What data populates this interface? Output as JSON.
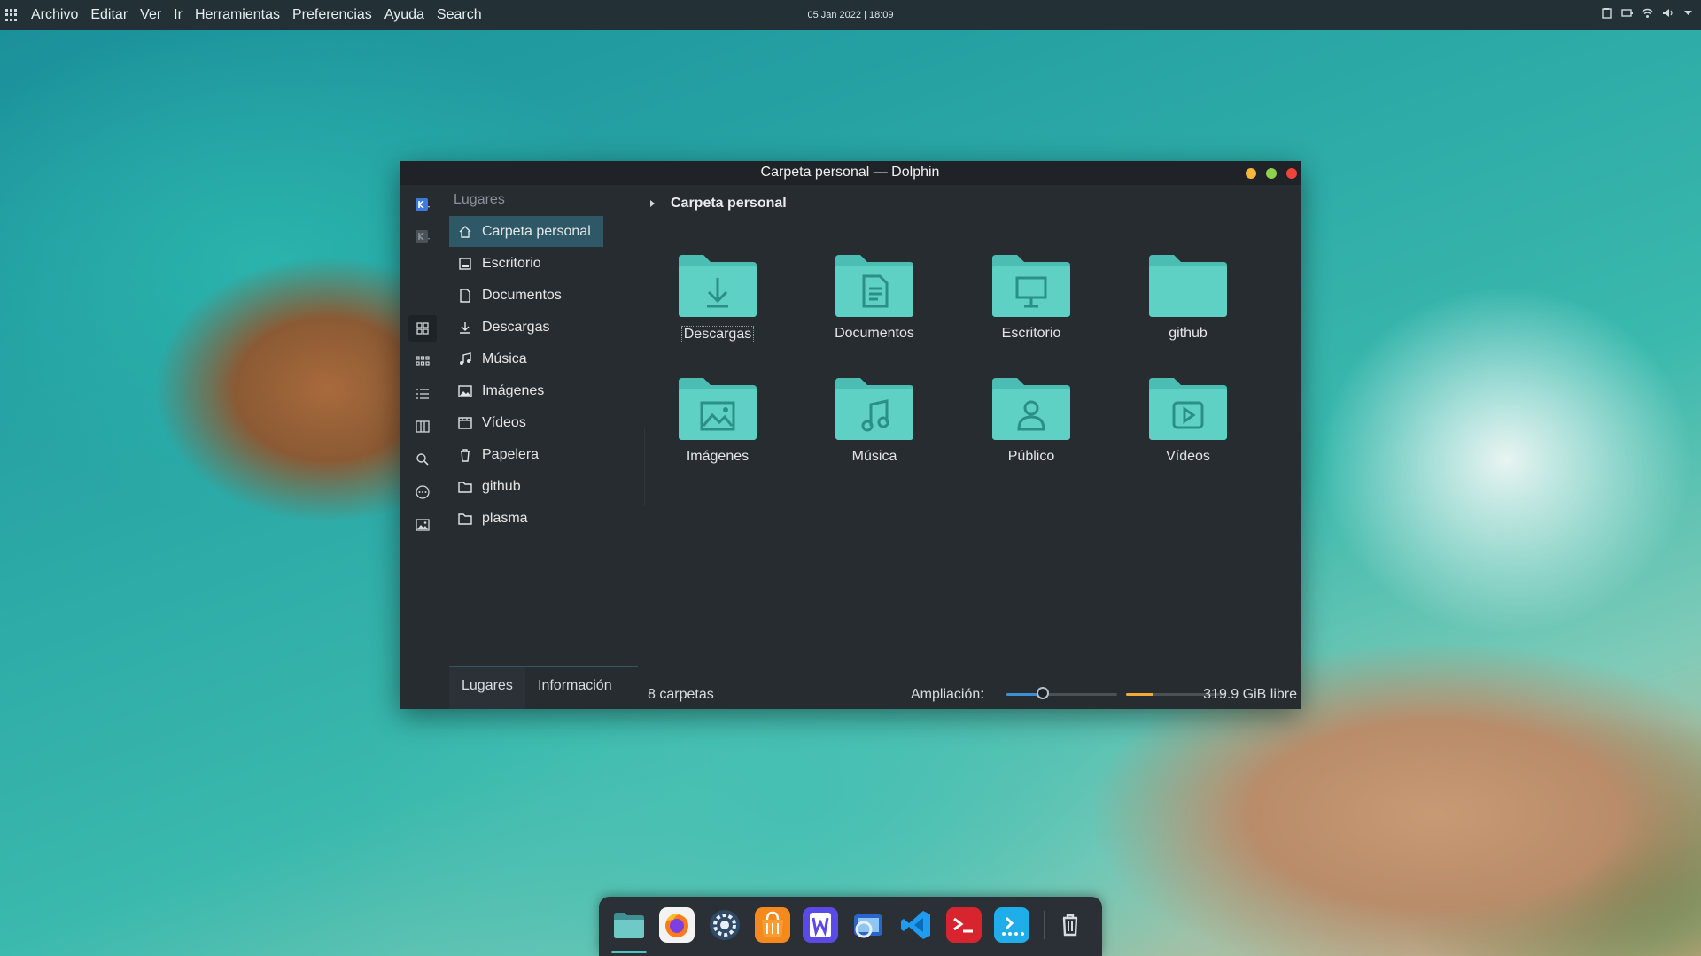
{
  "topbar": {
    "menus": [
      "Archivo",
      "Editar",
      "Ver",
      "Ir",
      "Herramientas",
      "Preferencias",
      "Ayuda",
      "Search"
    ],
    "clock": "05 Jan 2022 | 18:09"
  },
  "window": {
    "title": "Carpeta personal — Dolphin",
    "buttons": {
      "minimize_color": "#f6b73c",
      "maximize_color": "#8fd14f",
      "close_color": "#f0433a"
    }
  },
  "places": {
    "header": "Lugares",
    "items": [
      {
        "label": "Carpeta personal",
        "icon": "home-icon",
        "active": true
      },
      {
        "label": "Escritorio",
        "icon": "desktop-icon"
      },
      {
        "label": "Documentos",
        "icon": "document-icon"
      },
      {
        "label": "Descargas",
        "icon": "download-icon"
      },
      {
        "label": "Música",
        "icon": "music-icon"
      },
      {
        "label": "Imágenes",
        "icon": "image-icon"
      },
      {
        "label": "Vídeos",
        "icon": "video-icon"
      },
      {
        "label": "Papelera",
        "icon": "trash-icon"
      },
      {
        "label": "github",
        "icon": "folder-icon"
      },
      {
        "label": "plasma",
        "icon": "folder-icon"
      }
    ]
  },
  "bottom_tabs": {
    "places": "Lugares",
    "info": "Información"
  },
  "breadcrumb": {
    "current": "Carpeta personal"
  },
  "folders": [
    {
      "label": "Descargas",
      "emblem": "download"
    },
    {
      "label": "Documentos",
      "emblem": "document"
    },
    {
      "label": "Escritorio",
      "emblem": "desktop"
    },
    {
      "label": "github",
      "emblem": "none"
    },
    {
      "label": "Imágenes",
      "emblem": "image"
    },
    {
      "label": "Música",
      "emblem": "music"
    },
    {
      "label": "Público",
      "emblem": "user"
    },
    {
      "label": "Vídeos",
      "emblem": "video"
    }
  ],
  "status": {
    "count": "8 carpetas",
    "zoom_label": "Ampliación:",
    "zoom_value_fraction": 0.33,
    "free_space": "319.9 GiB libre",
    "used_space_fraction": 0.28
  },
  "colors": {
    "accent": "#2f5866",
    "folder": "#5fd0c4",
    "folder_tab": "#4cbdb2"
  },
  "dock": {
    "apps": [
      "files-icon",
      "firefox-icon",
      "settings-icon",
      "store-icon",
      "writer-icon",
      "screenshot-icon",
      "vscode-icon",
      "terminal-icon",
      "discover-icon"
    ],
    "trash": "trash-icon"
  }
}
